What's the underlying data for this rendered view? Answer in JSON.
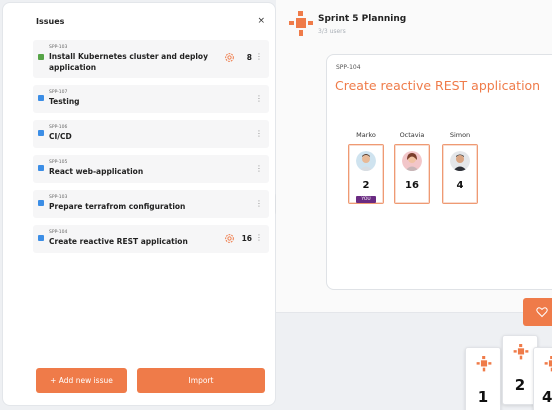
{
  "issues_panel": {
    "title": "Issues",
    "close_label": "×",
    "issues": [
      {
        "key": "SPP-103",
        "name": "Install Kubernetes cluster and deploy application",
        "points": "8",
        "type": "story",
        "icon_color": "#56a447",
        "has_settings_icon": true
      },
      {
        "key": "SPP-107",
        "name": "Testing",
        "points": "",
        "type": "task",
        "icon_color": "#3c8ee6",
        "has_settings_icon": false
      },
      {
        "key": "SPP-106",
        "name": "CI/CD",
        "points": "",
        "type": "task",
        "icon_color": "#3c8ee6",
        "has_settings_icon": false
      },
      {
        "key": "SPP-105",
        "name": "React web-application",
        "points": "",
        "type": "task",
        "icon_color": "#3c8ee6",
        "has_settings_icon": false
      },
      {
        "key": "SPP-103",
        "name": "Prepare terrafrom configuration",
        "points": "",
        "type": "task",
        "icon_color": "#3c8ee6",
        "has_settings_icon": false
      },
      {
        "key": "SPP-104",
        "name": "Create reactive REST application",
        "points": "16",
        "type": "task",
        "icon_color": "#3c8ee6",
        "has_settings_icon": true
      }
    ],
    "menu_icon": "⋮",
    "add_button_label": "+ Add new issue",
    "import_button_label": "Import"
  },
  "session": {
    "title": "Sprint 5 Planning",
    "users": "3/3 users"
  },
  "current_issue": {
    "key": "SPP-104",
    "title": "Create reactive REST application",
    "voters": [
      {
        "name": "Marko",
        "vote": "2",
        "is_you": true,
        "you_label": "YOU"
      },
      {
        "name": "Octavia",
        "vote": "16",
        "is_you": false
      },
      {
        "name": "Simon",
        "vote": "4",
        "is_you": false
      }
    ]
  },
  "deck": {
    "cards": [
      "1",
      "2",
      "4"
    ]
  },
  "colors": {
    "accent": "#ef7b49",
    "you_badge": "#6a2b82",
    "task_icon": "#3c8ee6",
    "story_icon": "#56a447"
  }
}
